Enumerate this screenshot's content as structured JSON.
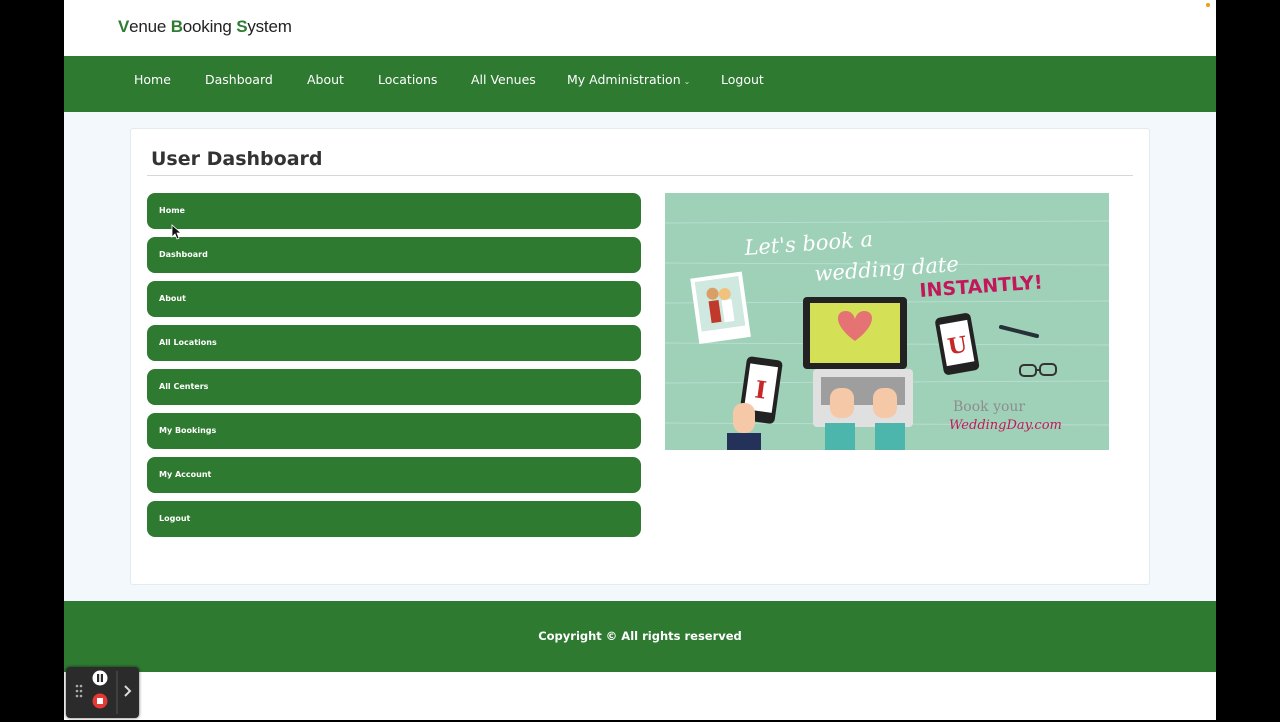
{
  "brand": {
    "parts": [
      {
        "cap": "V",
        "rest": "enue "
      },
      {
        "cap": "B",
        "rest": "ooking "
      },
      {
        "cap": "S",
        "rest": "ystem"
      }
    ]
  },
  "nav": {
    "home": "Home",
    "dashboard": "Dashboard",
    "about": "About",
    "locations": "Locations",
    "all_venues": "All Venues",
    "my_administration": "My Administration",
    "logout": "Logout"
  },
  "page": {
    "title": "User Dashboard"
  },
  "menu": {
    "items": [
      "Home",
      "Dashboard",
      "About",
      "All Locations",
      "All Centers",
      "My Bookings",
      "My Account",
      "Logout"
    ]
  },
  "promo": {
    "line1": "Let's book a",
    "line2": "wedding date",
    "line3": "INSTANTLY!",
    "phone_left_letter": "I",
    "phone_right_letter": "U",
    "logo_top": "Book your",
    "logo_bottom": "WeddingDay.com"
  },
  "footer": {
    "copyright": "Copyright © All rights reserved"
  },
  "colors": {
    "primary_green": "#2e7a31",
    "promo_bg": "#9fd0b8",
    "accent_pink": "#c2185b"
  }
}
